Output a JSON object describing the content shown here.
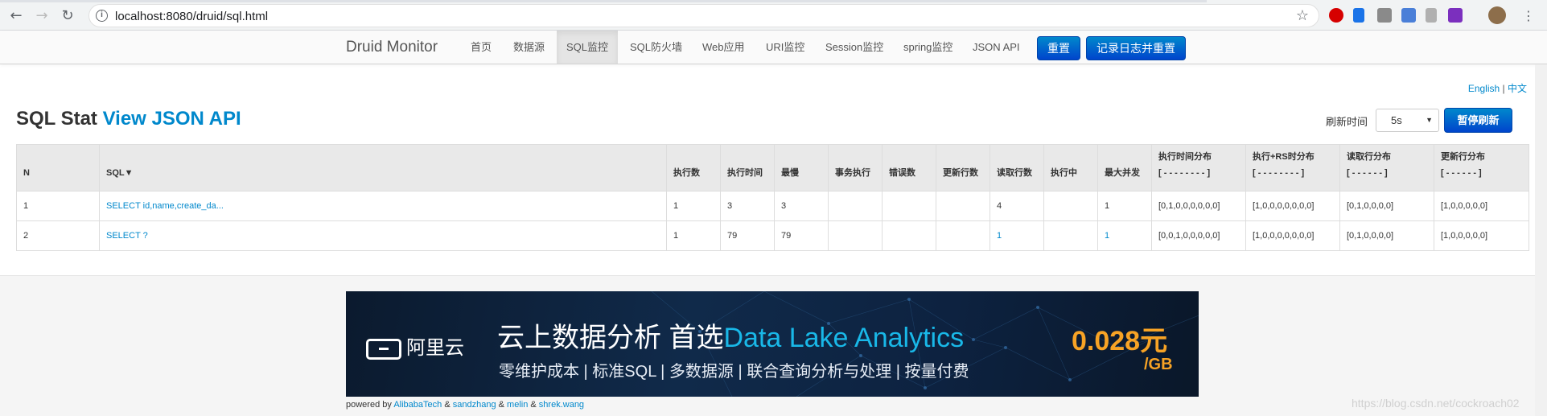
{
  "browser": {
    "url": "localhost:8080/druid/sql.html"
  },
  "navbar": {
    "brand": "Druid Monitor",
    "items": [
      "首页",
      "数据源",
      "SQL监控",
      "SQL防火墙",
      "Web应用",
      "URI监控",
      "Session监控",
      "spring监控",
      "JSON API"
    ],
    "active_item": "SQL监控",
    "reset_button": "重置",
    "log_reset_button": "记录日志并重置"
  },
  "lang": {
    "english": "English",
    "separator": "|",
    "chinese": "中文"
  },
  "page": {
    "title": "SQL Stat",
    "json_link": "View JSON API",
    "refresh_label": "刷新时间",
    "refresh_value": "5s",
    "pause_button": "暂停刷新"
  },
  "table": {
    "headers": [
      {
        "line1": "N",
        "line2": ""
      },
      {
        "line1": "SQL▼",
        "line2": ""
      },
      {
        "line1": "执行数",
        "line2": ""
      },
      {
        "line1": "执行时间",
        "line2": ""
      },
      {
        "line1": "最慢",
        "line2": ""
      },
      {
        "line1": "事务执行",
        "line2": ""
      },
      {
        "line1": "错误数",
        "line2": ""
      },
      {
        "line1": "更新行数",
        "line2": ""
      },
      {
        "line1": "读取行数",
        "line2": ""
      },
      {
        "line1": "执行中",
        "line2": ""
      },
      {
        "line1": "最大并发",
        "line2": ""
      },
      {
        "line1": "执行时间分布",
        "line2": "[ - - - - - - - - ]"
      },
      {
        "line1": "执行+RS时分布",
        "line2": "[ - - - - - - - - ]"
      },
      {
        "line1": "读取行分布",
        "line2": "[ - - - - - - ]"
      },
      {
        "line1": "更新行分布",
        "line2": "[ - - - - - - ]"
      }
    ],
    "rows": [
      [
        "1",
        "SELECT id,name,create_da...",
        "1",
        "3",
        "3",
        "",
        "",
        "",
        "4",
        "",
        "1",
        "[0,1,0,0,0,0,0,0]",
        "[1,0,0,0,0,0,0,0]",
        "[0,1,0,0,0,0]",
        "[1,0,0,0,0,0]"
      ],
      [
        "2",
        "SELECT ?",
        "1",
        "79",
        "79",
        "",
        "",
        "",
        "1",
        "",
        "1",
        "[0,0,1,0,0,0,0,0]",
        "[1,0,0,0,0,0,0,0]",
        "[0,1,0,0,0,0]",
        "[1,0,0,0,0,0]"
      ]
    ]
  },
  "banner": {
    "brand": "阿里云",
    "title_main": "云上数据分析 首选",
    "title_accent": "Data Lake Analytics",
    "subtitle": "零维护成本 | 标准SQL | 多数据源 | 联合查询分析与处理 | 按量付费",
    "price": "0.028元",
    "price_unit": "/GB"
  },
  "footer": {
    "powered_by": "powered by",
    "author1": "AlibabaTech",
    "author2": "sandzhang",
    "author3": "melin",
    "author4": "shrek.wang",
    "amp": "&"
  },
  "watermark": "https://blog.csdn.net/cockroach02",
  "colors": {
    "link": "#0088cc",
    "button_blue": "#0055cc",
    "price_orange": "#f7a325"
  }
}
